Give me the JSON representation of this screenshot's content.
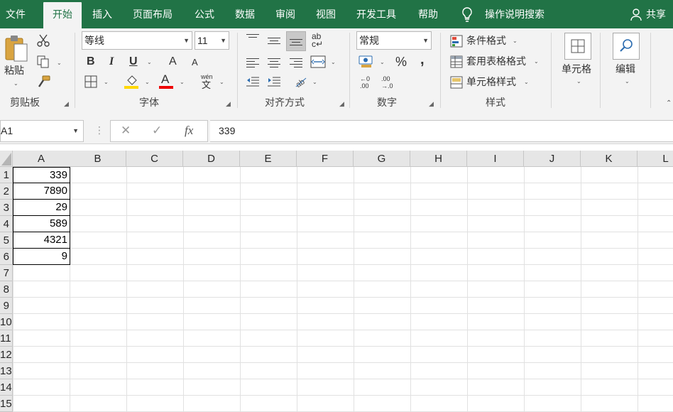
{
  "menu": {
    "tabs": [
      "文件",
      "开始",
      "插入",
      "页面布局",
      "公式",
      "数据",
      "审阅",
      "视图",
      "开发工具",
      "帮助"
    ],
    "active_tab": "开始",
    "tell_me": "操作说明搜索",
    "share": "共享"
  },
  "ribbon": {
    "clipboard": {
      "paste_label": "粘贴",
      "group_label": "剪贴板"
    },
    "font": {
      "font_name": "等线",
      "font_size": "11",
      "group_label": "字体",
      "bold": "B",
      "italic": "I",
      "underline": "U",
      "grow": "A",
      "shrink": "A",
      "color_a": "A",
      "phonetic": "wén"
    },
    "alignment": {
      "group_label": "对齐方式"
    },
    "number": {
      "format": "常规",
      "percent": "%",
      "comma": ",",
      "inc_decimal": ".00",
      "dec_decimal": ".00",
      "group_label": "数字"
    },
    "styles": {
      "conditional": "条件格式",
      "table_format": "套用表格格式",
      "cell_styles": "单元格样式",
      "group_label": "样式"
    },
    "cells": {
      "label": "单元格"
    },
    "editing": {
      "label": "编辑"
    }
  },
  "formula_bar": {
    "name_box": "A1",
    "cancel": "✕",
    "enter": "✓",
    "fx": "fx",
    "content": "339"
  },
  "sheet": {
    "columns": [
      "A",
      "B",
      "C",
      "D",
      "E",
      "F",
      "G",
      "H",
      "I",
      "J",
      "K",
      "L"
    ],
    "rows": [
      "1",
      "2",
      "3",
      "4",
      "5",
      "6",
      "7",
      "8",
      "9",
      "10",
      "11",
      "12",
      "13",
      "14",
      "15"
    ],
    "column_a_values": [
      "339",
      "7890",
      "29",
      "589",
      "4321",
      "9"
    ]
  },
  "colors": {
    "accent": "#217346",
    "ribbon_bg": "#f3f3f3"
  }
}
